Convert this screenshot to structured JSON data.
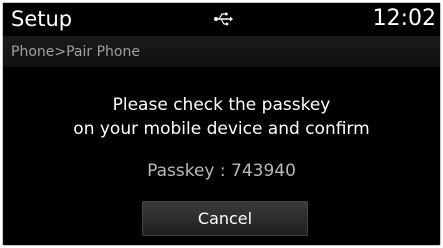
{
  "status": {
    "title": "Setup",
    "clock": "12:02",
    "icon": "usb-icon"
  },
  "breadcrumb": "Phone>Pair Phone",
  "dialog": {
    "message_line1": "Please check the passkey",
    "message_line2": "on your mobile device and confirm",
    "passkey": "Passkey : 743940",
    "cancel_label": "Cancel"
  },
  "colors": {
    "background": "#000000",
    "text": "#ffffff",
    "muted_text": "#a0a0a0"
  }
}
